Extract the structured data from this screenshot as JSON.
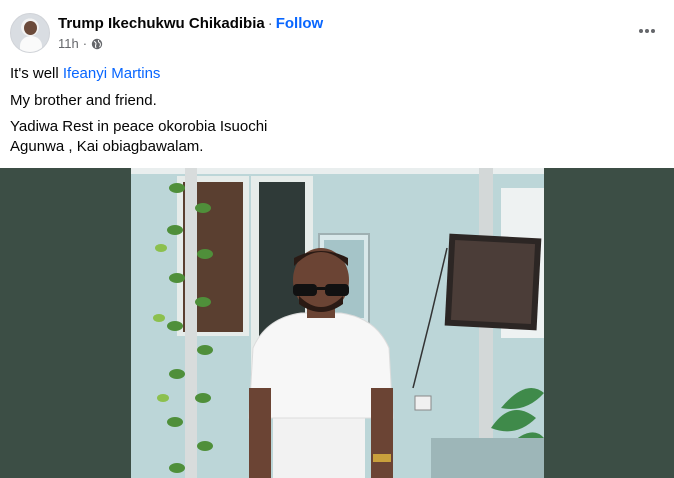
{
  "post": {
    "author": "Trump Ikechukwu Chikadibia",
    "separator": "·",
    "follow": "Follow",
    "time": "11h",
    "time_separator": "·",
    "visibility_icon": "globe-icon",
    "more_icon": "more-options-icon"
  },
  "text": {
    "line1_prefix": "It's well ",
    "line1_mention": "Ifeanyi Martins",
    "line2": "My brother and friend.",
    "line3": "Yadiwa Rest in peace okorobia Isuochi",
    "line4": "Agunwa , Kai obiagbawalam."
  },
  "colors": {
    "link": "#0866ff",
    "text": "#050505",
    "secondary": "#65676b",
    "media_background": "#3c4e45"
  }
}
